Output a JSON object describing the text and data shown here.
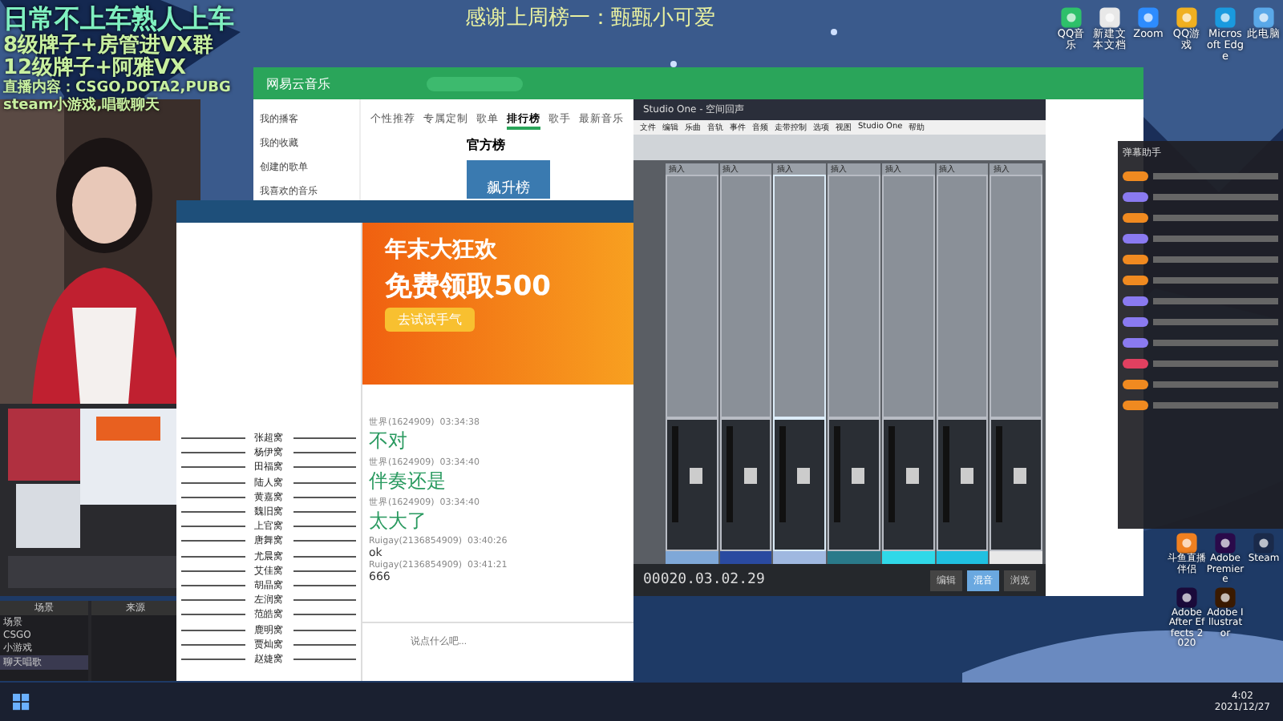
{
  "overlay": {
    "lines": [
      "日常不上车熟人上车",
      "8级牌子+房管进VX群",
      "12级牌子+阿雅VX",
      "直播内容：CSGO,DOTA2,PUBG",
      "steam小游戏,唱歌聊天"
    ],
    "thanks": "感谢上周榜一：甄甄小可爱"
  },
  "netease": {
    "title": "网易云音乐",
    "tabs": [
      {
        "label": "个性推荐",
        "selected": false
      },
      {
        "label": "专属定制",
        "selected": false
      },
      {
        "label": "歌单",
        "selected": false
      },
      {
        "label": "排行榜",
        "selected": true
      },
      {
        "label": "歌手",
        "selected": false
      },
      {
        "label": "最新音乐",
        "selected": false
      }
    ],
    "sidebar": [
      "我的播客",
      "我的收藏",
      "创建的歌单",
      "我喜欢的音乐"
    ],
    "heading": "官方榜",
    "card": "飙升榜"
  },
  "chat": {
    "banner_title": "年末大狂欢",
    "banner_offer": "免费领取500",
    "banner_button": "去试试手气",
    "members": [
      "张超窝",
      "杨伊窝",
      "田福窝",
      "陆人窝",
      "黄嘉窝",
      "魏旧窝",
      "上官窝",
      "唐舞窝",
      "尤晨窝",
      "艾佳窝",
      "胡晶窝",
      "左润窝",
      "范皓窝",
      "鹿明窝",
      "贾灿窝",
      "赵婕窝"
    ],
    "messages": [
      {
        "user": "世界(1624909)",
        "time": "03:34:38",
        "text": "不对",
        "kind": "big"
      },
      {
        "user": "世界(1624909)",
        "time": "03:34:40",
        "text": "伴奏还是",
        "kind": "big"
      },
      {
        "user": "世界(1624909)",
        "time": "03:34:40",
        "text": "太大了",
        "kind": "big"
      },
      {
        "user": "Ruigay(2136854909)",
        "time": "03:40:26",
        "text": "ok",
        "kind": "small"
      },
      {
        "user": "Ruigay(2136854909)",
        "time": "03:41:21",
        "text": "666",
        "kind": "small"
      }
    ],
    "placeholder": "说点什么吧..."
  },
  "daw": {
    "title": "Studio One - 空间回声",
    "menu": [
      "文件",
      "编辑",
      "乐曲",
      "音轨",
      "事件",
      "音频",
      "走带控制",
      "选项",
      "视图",
      "Studio One",
      "帮助"
    ],
    "channels": [
      {
        "color": "#7fa8d8",
        "selected": false
      },
      {
        "color": "#2a4aa0",
        "selected": false
      },
      {
        "color": "#9fb8e0",
        "selected": true
      },
      {
        "color": "#2a7a8a",
        "selected": false
      },
      {
        "color": "#30d8e8",
        "selected": false
      },
      {
        "color": "#20c0e0",
        "selected": false
      },
      {
        "color": "#e8e8e8",
        "selected": false
      }
    ],
    "insert_labels": [
      "插入",
      "插入",
      "插入",
      "插入",
      "插入",
      "插入",
      "插入"
    ],
    "time": "00020.03.02.29",
    "views": [
      {
        "label": "编辑",
        "selected": false
      },
      {
        "label": "混音",
        "selected": true
      },
      {
        "label": "浏览",
        "selected": false
      }
    ]
  },
  "desktop_icons": [
    {
      "label": "QQ音乐",
      "kind": "note"
    },
    {
      "label": "新建文本文档",
      "kind": "doc"
    },
    {
      "label": "Zoom",
      "kind": "cam"
    },
    {
      "label": "QQ游戏",
      "kind": "game"
    },
    {
      "label": "Microsoft Edge",
      "kind": "edge"
    },
    {
      "label": "此电脑",
      "kind": "pc"
    }
  ],
  "desktop_icons_lower": [
    {
      "label": "斗鱼直播伴侣",
      "kind": "fish"
    },
    {
      "label": "Adobe Premiere",
      "kind": "pr"
    },
    {
      "label": "Steam",
      "kind": "steam"
    },
    {
      "label": "Adobe After Effects 2020",
      "kind": "ae"
    },
    {
      "label": "Adobe Illustrator",
      "kind": "ai"
    }
  ],
  "danmaku": {
    "title": "弹幕助手",
    "rows": [
      {
        "color": "#f08a20"
      },
      {
        "color": "#8a7af0"
      },
      {
        "color": "#f08a20"
      },
      {
        "color": "#8a7af0"
      },
      {
        "color": "#f08a20"
      },
      {
        "color": "#f08a20"
      },
      {
        "color": "#8a7af0"
      },
      {
        "color": "#8a7af0"
      },
      {
        "color": "#8a7af0"
      },
      {
        "color": "#e04060"
      },
      {
        "color": "#f08a20"
      },
      {
        "color": "#f08a20"
      }
    ]
  },
  "obs": {
    "scenes_title": "场景",
    "scenes": [
      {
        "label": "场景",
        "selected": false
      },
      {
        "label": "CSGO",
        "selected": false
      },
      {
        "label": "小游戏",
        "selected": false
      },
      {
        "label": "聊天唱歌",
        "selected": true
      }
    ],
    "sources_title": "来源"
  },
  "taskbar": {
    "time": "4:02",
    "date": "2021/12/27"
  }
}
